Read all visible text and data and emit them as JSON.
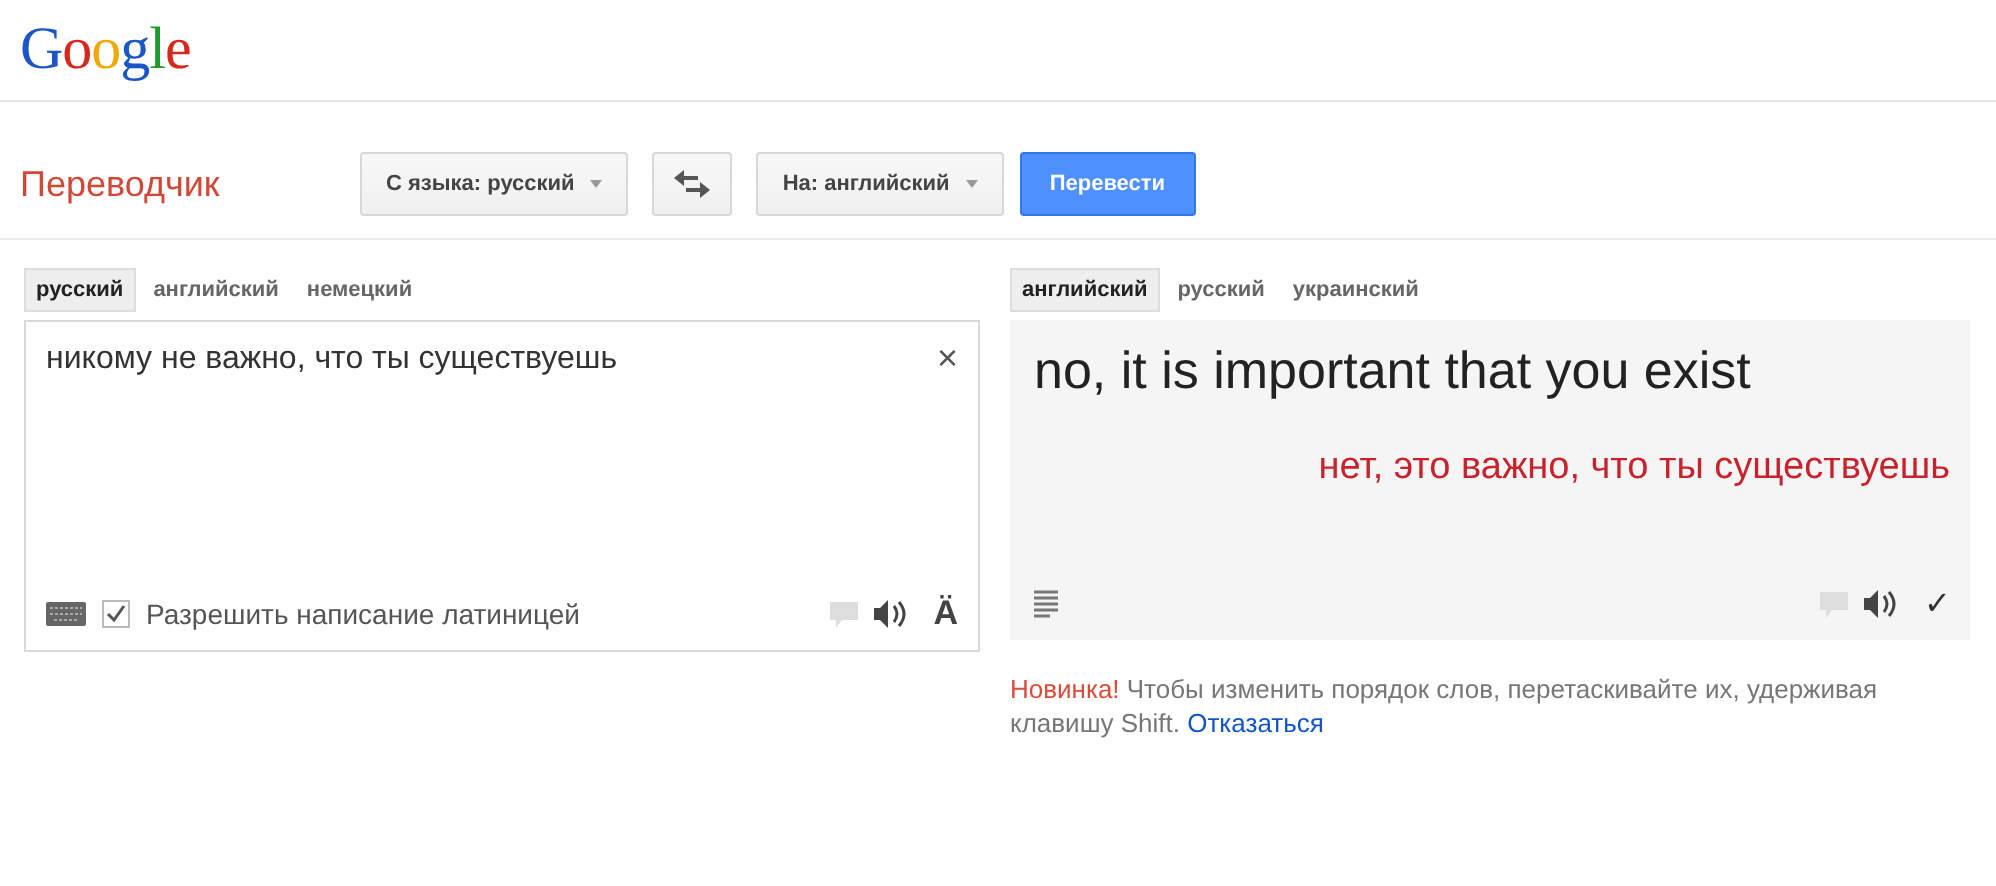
{
  "logo": "Google",
  "toolbar": {
    "title": "Переводчик",
    "source_language": "С языка: русский",
    "target_language": "На: английский",
    "translate_button": "Перевести"
  },
  "source": {
    "tabs": [
      {
        "label": "русский",
        "selected": true
      },
      {
        "label": "английский",
        "selected": false
      },
      {
        "label": "немецкий",
        "selected": false
      }
    ],
    "text": "никому не важно, что ты существуешь",
    "clear": "×",
    "transliteration": {
      "label": "Разрешить написание латиницей",
      "checked": true
    },
    "accent": "Ä"
  },
  "result": {
    "tabs": [
      {
        "label": "английский",
        "selected": true
      },
      {
        "label": "русский",
        "selected": false
      },
      {
        "label": "украинский",
        "selected": false
      }
    ],
    "text": "no, it is important that you exist",
    "back_translation": "нет, это важно, что ты существуешь",
    "check": "✓"
  },
  "notice": {
    "badge": "Новинка!",
    "text": "Чтобы изменить порядок слов, перетаскивайте их, удерживая клавишу Shift.",
    "link": "Отказаться"
  }
}
